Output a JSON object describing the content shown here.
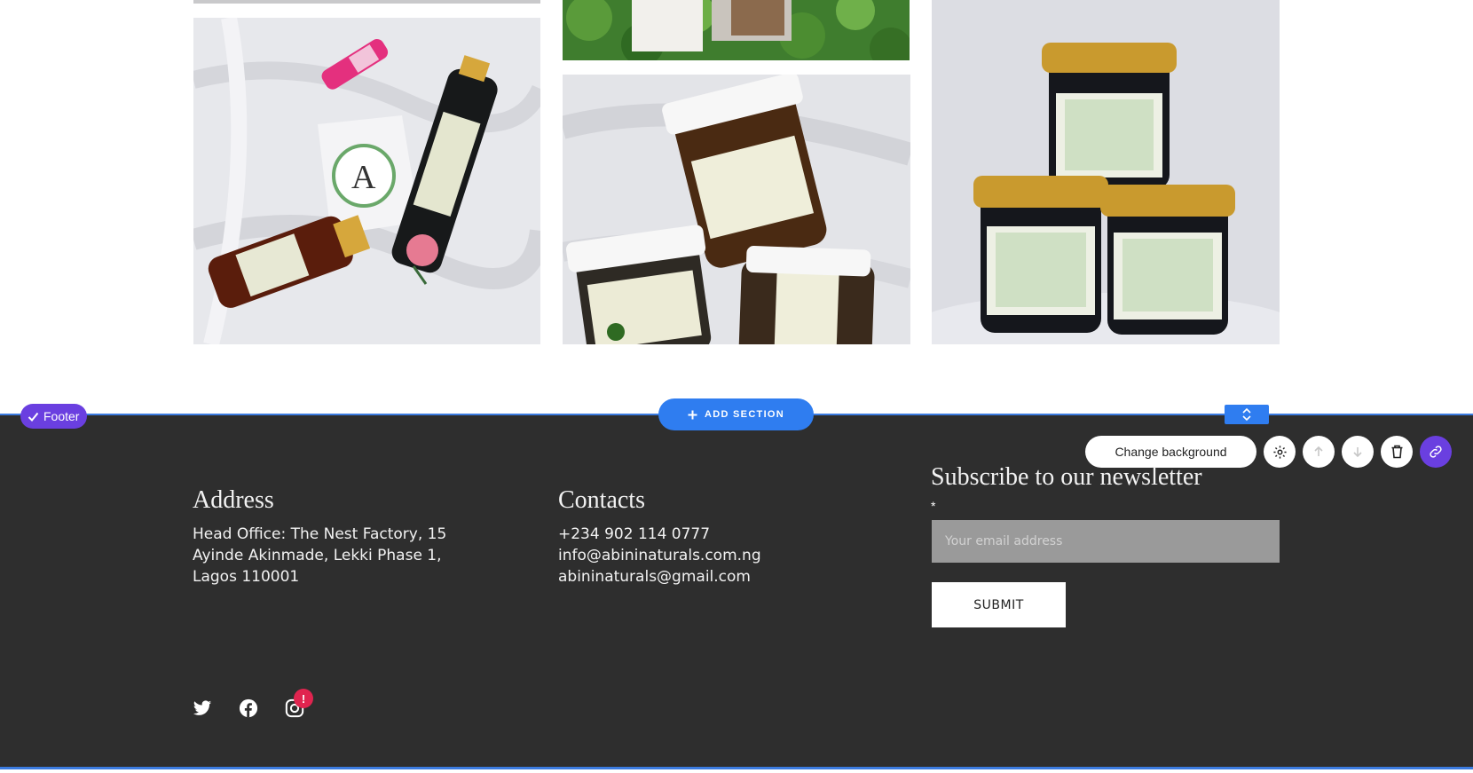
{
  "gallery": {
    "photos": [
      {
        "alt": "Abini toner and oil bottles on white fabric"
      },
      {
        "alt": "Abini jars stacked on white fabric"
      },
      {
        "alt": "Three jars of Abini exfoliating sugar scrub"
      },
      {
        "alt": "Product box on green foliage"
      }
    ]
  },
  "editor": {
    "section_badge": "Footer",
    "add_section": "ADD SECTION",
    "change_background": "Change background"
  },
  "footer": {
    "address": {
      "heading": "Address",
      "lines": [
        "Head Office: The Nest Factory, 15",
        "Ayinde Akinmade, Lekki Phase 1,",
        "Lagos 110001"
      ]
    },
    "contacts": {
      "heading": "Contacts",
      "lines": [
        "+234 902 114 0777",
        "info@abininaturals.com.ng",
        "abininaturals@gmail.com"
      ]
    },
    "newsletter": {
      "heading": "Subscribe to our newsletter",
      "required_mark": "*",
      "email_placeholder": "Your email address",
      "submit_label": "SUBMIT"
    },
    "social": {
      "icons": [
        "twitter-icon",
        "facebook-icon",
        "instagram-icon"
      ],
      "notification_badge": "!"
    }
  },
  "colors": {
    "footer_bg": "#2e2e2e",
    "accent_blue": "#2f7df0",
    "editor_purple": "#6a3fe0",
    "notification_red": "#e0244f"
  }
}
